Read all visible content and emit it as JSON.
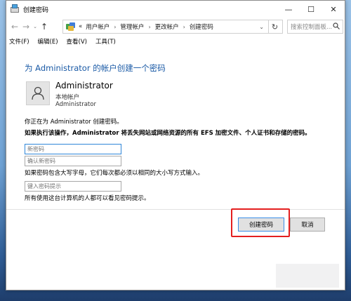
{
  "window": {
    "title": "创建密码",
    "controls": {
      "minimize": "—",
      "maximize": "☐",
      "close": "✕"
    }
  },
  "nav": {
    "back": "←",
    "forward": "→",
    "dropdown": "⌄",
    "up": "↑"
  },
  "address": {
    "prefix": "«",
    "crumbs": [
      "用户帐户",
      "管理帐户",
      "更改帐户",
      "创建密码"
    ],
    "separator": "›",
    "dropdown": "⌄",
    "refresh": "↻"
  },
  "search": {
    "placeholder": "搜索控制面板..."
  },
  "menu": {
    "items": [
      "文件(F)",
      "编辑(E)",
      "查看(V)",
      "工具(T)"
    ]
  },
  "main": {
    "heading": "为 Administrator 的帐户创建一个密码",
    "account": {
      "name": "Administrator",
      "type": "本地帐户",
      "role": "Administrator"
    },
    "info_line": "你正在为 Administrator 创建密码。",
    "warning_line": "如果执行该操作，Administrator 将丢失网站或网络资源的所有 EFS 加密文件、个人证书和存储的密码。",
    "fields": {
      "new_password": "新密码",
      "confirm_password": "确认新密码",
      "hint": "键入密码提示"
    },
    "case_note": "如果密码包含大写字母，它们每次都必须以相同的大小写方式输入。",
    "hint_note": "所有使用这台计算机的人都可以看见密码提示。"
  },
  "buttons": {
    "create": "创建密码",
    "cancel": "取消"
  },
  "colors": {
    "heading": "#1a5aa6",
    "highlight": "#e41f1f",
    "focus": "#2f86d8"
  }
}
